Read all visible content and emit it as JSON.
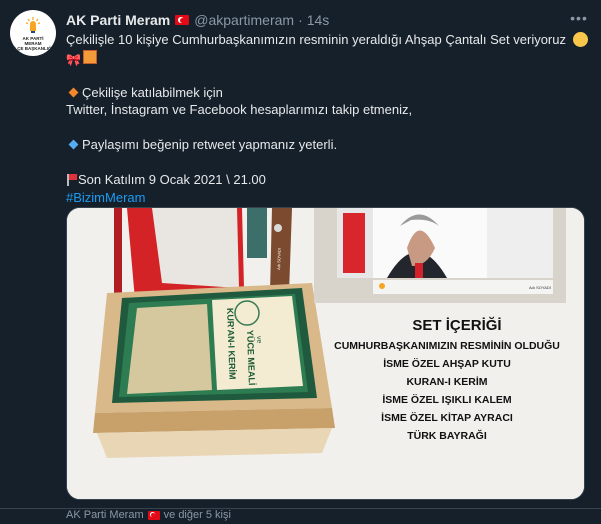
{
  "tweet": {
    "display_name": "AK Parti Meram",
    "handle": "@akpartimeram",
    "separator": "·",
    "time": "14s",
    "avatar_text": [
      "AK PARTİ",
      "MERAM",
      "İLÇE BAŞKANLIĞI"
    ],
    "text_lines": [
      "Çekilişle 10 kişiye Cumhurbaşkanımızın resminin yeraldığı Ahşap Çantalı Set veriyoruz",
      "Çekilişe katılabilmek için",
      "Twitter, İnstagram ve Facebook hesaplarımızı takip etmeniz,",
      "Paylaşımı beğenip retweet yapmanız yeterli.",
      "Son Katılım 9 Ocak 2021 \\ 21.00"
    ],
    "hashtag": "#BizimMeram",
    "icons": [
      "smile-emoji",
      "ribbon-emoji",
      "gift-emoji",
      "orange-diamond",
      "blue-diamond",
      "red-flag-emoji",
      "turkey-flag",
      "more-icon"
    ]
  },
  "image": {
    "set_title": "SET İÇERİĞİ",
    "set_items": [
      "CUMHURBAŞKANIMIZIN RESMİNİN OLDUĞU",
      "İSME ÖZEL AHŞAP KUTU",
      "KURAN-I KERİM",
      "İSME ÖZEL IŞIKLI KALEM",
      "İSME ÖZEL KİTAP AYRACI",
      "TÜRK BAYRAĞI"
    ],
    "book_title_top": "KUR'AN-I KERİM",
    "book_title_sub": "ve",
    "book_title_bottom": "YÜCE MEALİ",
    "bookmark_text": "Adı SOYADI",
    "frame_caption": "Adı SOYADI"
  },
  "footer": {
    "retweet_by": "AK Parti Meram",
    "others": "ve diğer 5 kişi"
  },
  "colors": {
    "background": "#15202b",
    "text": "#e7e9ea",
    "muted": "#8b98a5",
    "link": "#1d9bf0"
  }
}
